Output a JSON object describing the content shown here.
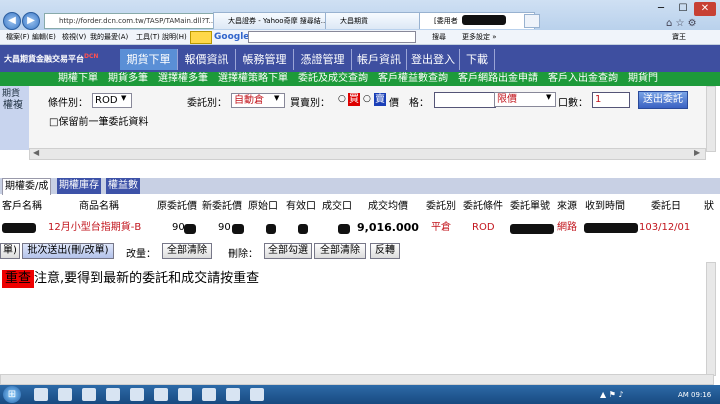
{
  "browser": {
    "url": "http://forder.dcn.com.tw/TASP/TAMain.dll?T...",
    "tabs": [
      {
        "label": "大昌證券 - Yahoo奇摩 搜尋結..."
      },
      {
        "label": "大昌期貨"
      },
      {
        "label": "[委用者"
      }
    ],
    "menu": [
      "檔案(F)",
      "編輯(E)",
      "檢視(V)",
      "我的最愛(A)",
      "工具(T)",
      "說明(H)"
    ],
    "google_label": "Google",
    "right_tools": [
      "搜尋",
      "更多設定 »"
    ],
    "user_label": "寶王"
  },
  "site": {
    "brand": "大昌期貨金融交易平台",
    "brand_badge": "DCN",
    "nav": [
      "期貨下單",
      "報價資訊",
      "帳務管理",
      "憑證管理",
      "帳戶資訊",
      "登出登入",
      "下載"
    ],
    "subnav_text": "期權下單　期貨多筆　選擇權多筆　選擇權策略下單　委託及成交查詢　客戶權益數查詢　客戶網路出金申請　客戶入出金查詢　期貨門",
    "left_tab_top": "期貨",
    "left_tab_bottom": "權複"
  },
  "order_form": {
    "condition_label": "條件別：",
    "condition_value": "ROD",
    "order_type_label": "委託別：",
    "order_type_value": "自動倉",
    "side_label": "買賣別：",
    "buy_label": "買",
    "sell_label": "賣",
    "price_suffix": "價　格：",
    "price_value": "",
    "price_type_value": "限價",
    "qty_label": "口數：",
    "qty_value": "1",
    "submit_label": "送出委託",
    "keep_label": "□保留前一筆委託資料"
  },
  "tabs": [
    "期權委/成",
    "期權庫存",
    "權益數"
  ],
  "grid": {
    "headers": [
      "客戶名稱",
      "商品名稱",
      "原委託價",
      "新委託價",
      "原始口",
      "有效口",
      "成交口",
      "成交均價",
      "委託別",
      "委託條件",
      "委託單號",
      "來源",
      "收到時間",
      "委託日",
      "狀"
    ],
    "row": {
      "product": "12月小型台指期貨-B",
      "orig_price": "90",
      "new_price": "90",
      "avg_price": "9,016.000",
      "order_type": "平倉",
      "condition": "ROD",
      "source": "網路",
      "date": "103/12/01"
    }
  },
  "actions": {
    "left_clip": "單)",
    "batch_send": "批次送出(刪/改單)",
    "change_label": "改量：",
    "clear_all_1": "全部清除",
    "delete_label": "刪除：",
    "check_all": "全部勾選",
    "clear_all_2": "全部清除",
    "reverse": "反轉"
  },
  "message": {
    "badge": "重查",
    "text": "注意,要得到最新的委託和成交請按重查"
  },
  "taskbar": {
    "start": "⊞",
    "time": "AM 09:16"
  }
}
